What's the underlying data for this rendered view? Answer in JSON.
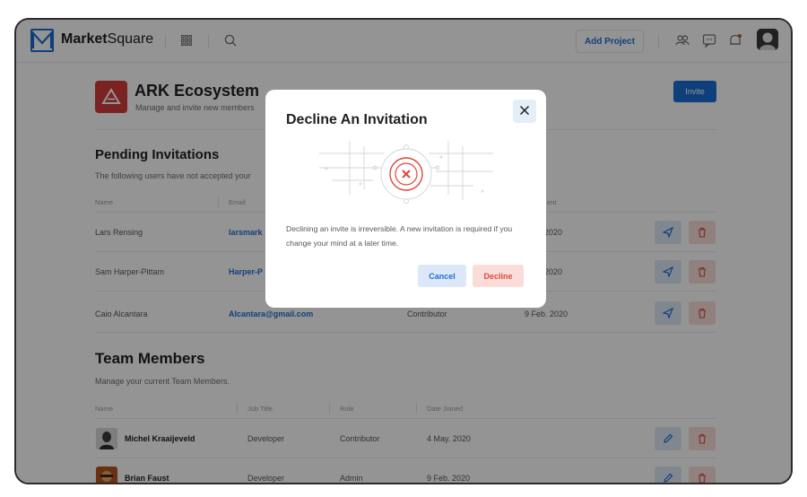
{
  "header": {
    "brand_bold": "Market",
    "brand_light": "Square",
    "add_project_label": "Add Project"
  },
  "project": {
    "title": "ARK Ecosystem",
    "subtitle": "Manage and invite new members",
    "invite_label": "Invite"
  },
  "pending": {
    "title": "Pending Invitations",
    "subtitle": "The following users have not accepted your",
    "columns": [
      "Name",
      "Email",
      "ent"
    ],
    "rows": [
      {
        "name": "Lars Rensing",
        "email": "larsmark",
        "role": "",
        "date": ". 2020"
      },
      {
        "name": "Sam Harper-Pittam",
        "email": "Harper-P",
        "role": "",
        "date": ". 2020"
      },
      {
        "name": "Caio Alcantara",
        "email": "Alcantara@gmail.com",
        "role": "Contributor",
        "date": "9 Feb. 2020"
      }
    ]
  },
  "team": {
    "title": "Team Members",
    "subtitle": "Manage your current Team Members.",
    "columns": [
      "Name",
      "Job Title",
      "Role",
      "Date Joined"
    ],
    "rows": [
      {
        "name": "Michel Kraaijeveld",
        "job": "Developer",
        "role": "Contributor",
        "date": "4 May. 2020"
      },
      {
        "name": "Brian Faust",
        "job": "Developer",
        "role": "Admin",
        "date": "9 Feb. 2020"
      }
    ]
  },
  "modal": {
    "title": "Decline An Invitation",
    "message": "Declining an invite is irreversible. A new invitation is required if you change your mind at a later time.",
    "cancel_label": "Cancel",
    "decline_label": "Decline"
  },
  "colors": {
    "primary": "#1d6fd4",
    "danger": "#d94c43",
    "brand_red": "#d43c3c"
  },
  "icons": {
    "grid": "grid-icon",
    "search": "search-icon",
    "users": "users-icon",
    "chat": "chat-icon",
    "bell": "bell-icon",
    "send": "send-icon",
    "trash": "trash-icon",
    "edit": "pencil-icon",
    "close": "close-icon"
  }
}
